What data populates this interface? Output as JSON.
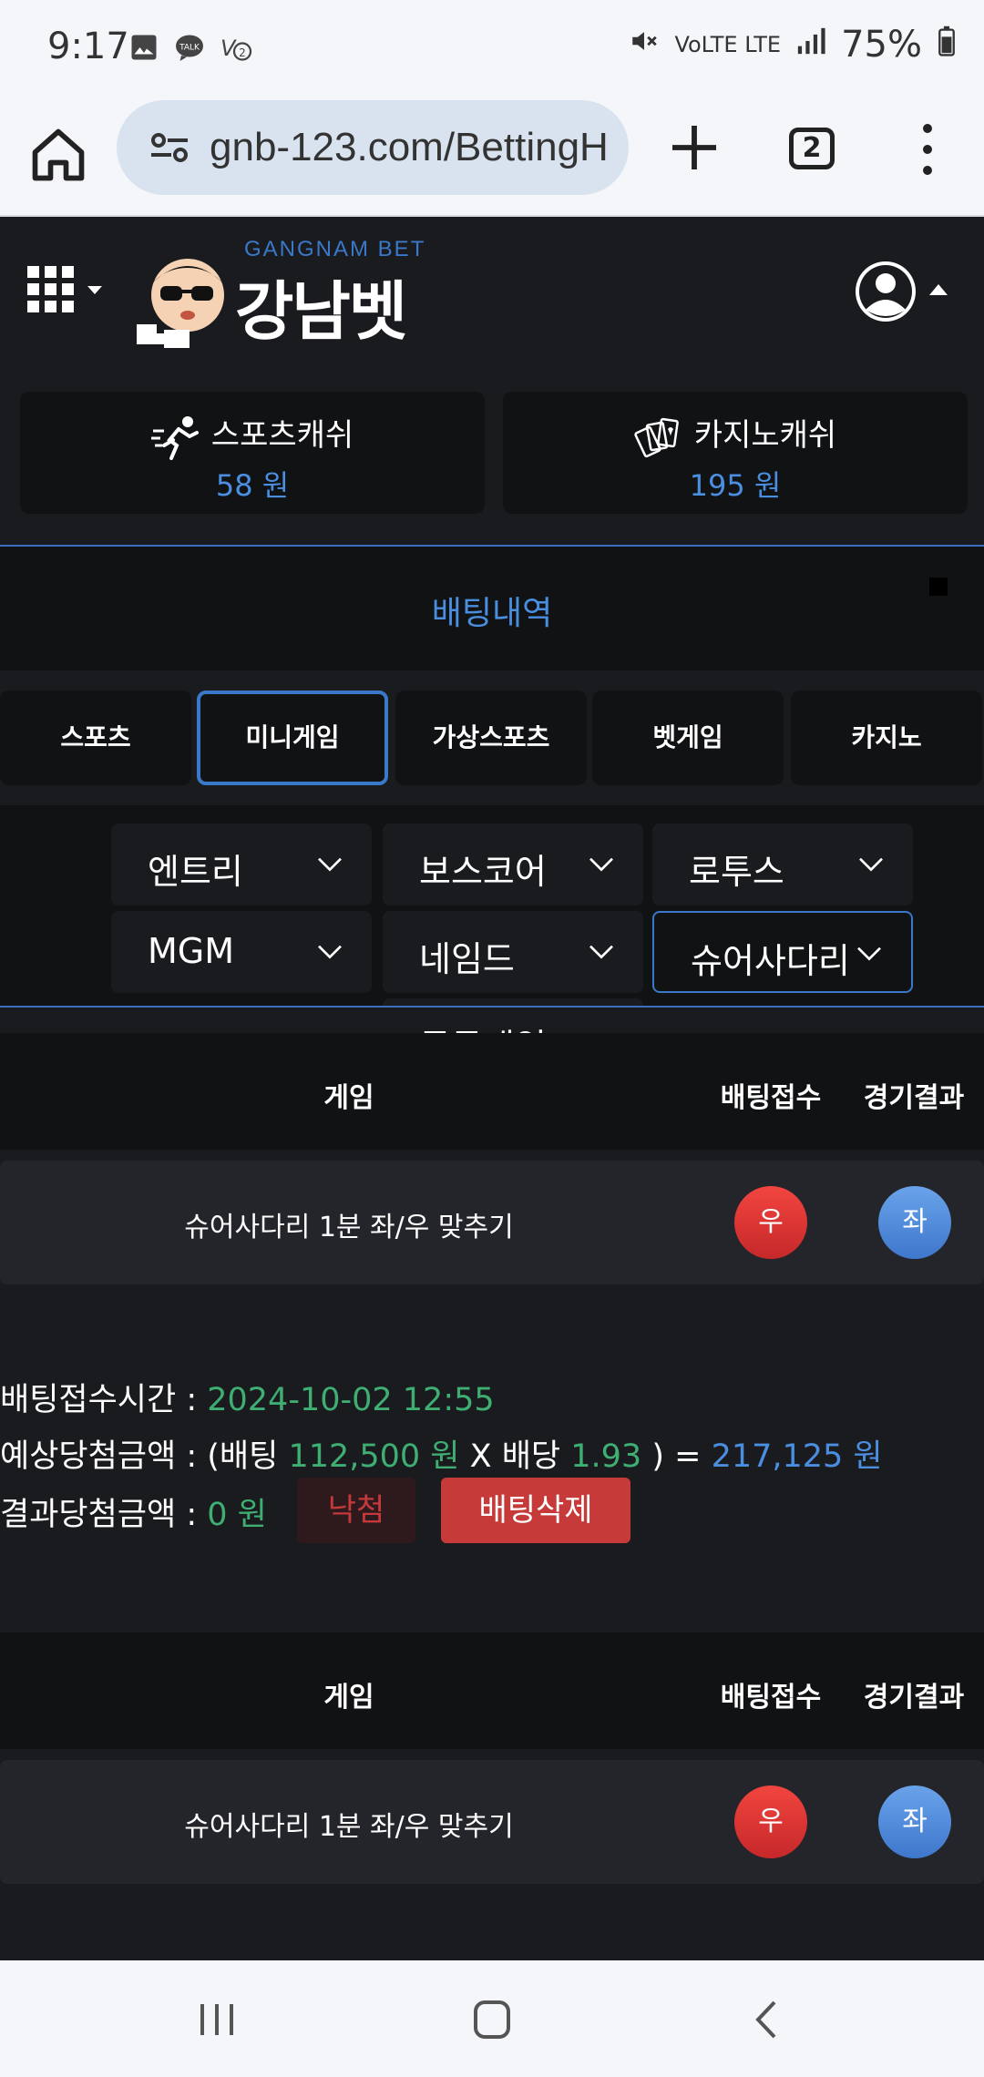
{
  "status_bar": {
    "time": "9:17",
    "notif_icons": [
      "image-icon",
      "talk-icon",
      "v2-icon"
    ],
    "network": "VoLTE LTE",
    "battery": "75%"
  },
  "browser": {
    "url": "gnb-123.com/BettingH",
    "tab_count": "2"
  },
  "site": {
    "logo_sub": "GANGNAM BET",
    "logo_main": "강남벳"
  },
  "cash": {
    "sports_label": "스포츠캐쉬",
    "sports_value": "58 원",
    "casino_label": "카지노캐쉬",
    "casino_value": "195 원"
  },
  "page_title": "배팅내역",
  "category_tabs": [
    "스포츠",
    "미니게임",
    "가상스포츠",
    "벳게임",
    "카지노"
  ],
  "active_category": "미니게임",
  "subgames": [
    "엔트리",
    "보스코어",
    "로투스",
    "MGM",
    "네임드",
    "슈어사다리"
  ],
  "subgames_overflow": "동국게임",
  "active_subgame": "슈어사다리",
  "table_headers": {
    "game": "게임",
    "bet": "배팅접수",
    "result": "경기결과"
  },
  "bets": [
    {
      "game": "슈어사다리 1분 좌/우 맞추기",
      "bet_pick": "우",
      "result_pick": "좌",
      "time_label": "배팅접수시간 : ",
      "time_value": "2024-10-02 12:55",
      "expected_label": "예상당첨금액 : (배팅 ",
      "stake": "112,500 원",
      "x_label": " X 배당 ",
      "odds": "1.93",
      "eq_label": " ) = ",
      "expected_value": "217,125 원",
      "result_label": "결과당첨금액 : ",
      "result_value": "0 원",
      "status": "낙첨",
      "delete_label": "배팅삭제"
    },
    {
      "game": "슈어사다리 1분 좌/우 맞추기",
      "bet_pick": "우",
      "result_pick": "좌"
    }
  ],
  "colors": {
    "accent_blue": "#4a8ee0",
    "value_green": "#3fae72",
    "delete_red": "#c63a39",
    "background": "#1a1b1f"
  }
}
